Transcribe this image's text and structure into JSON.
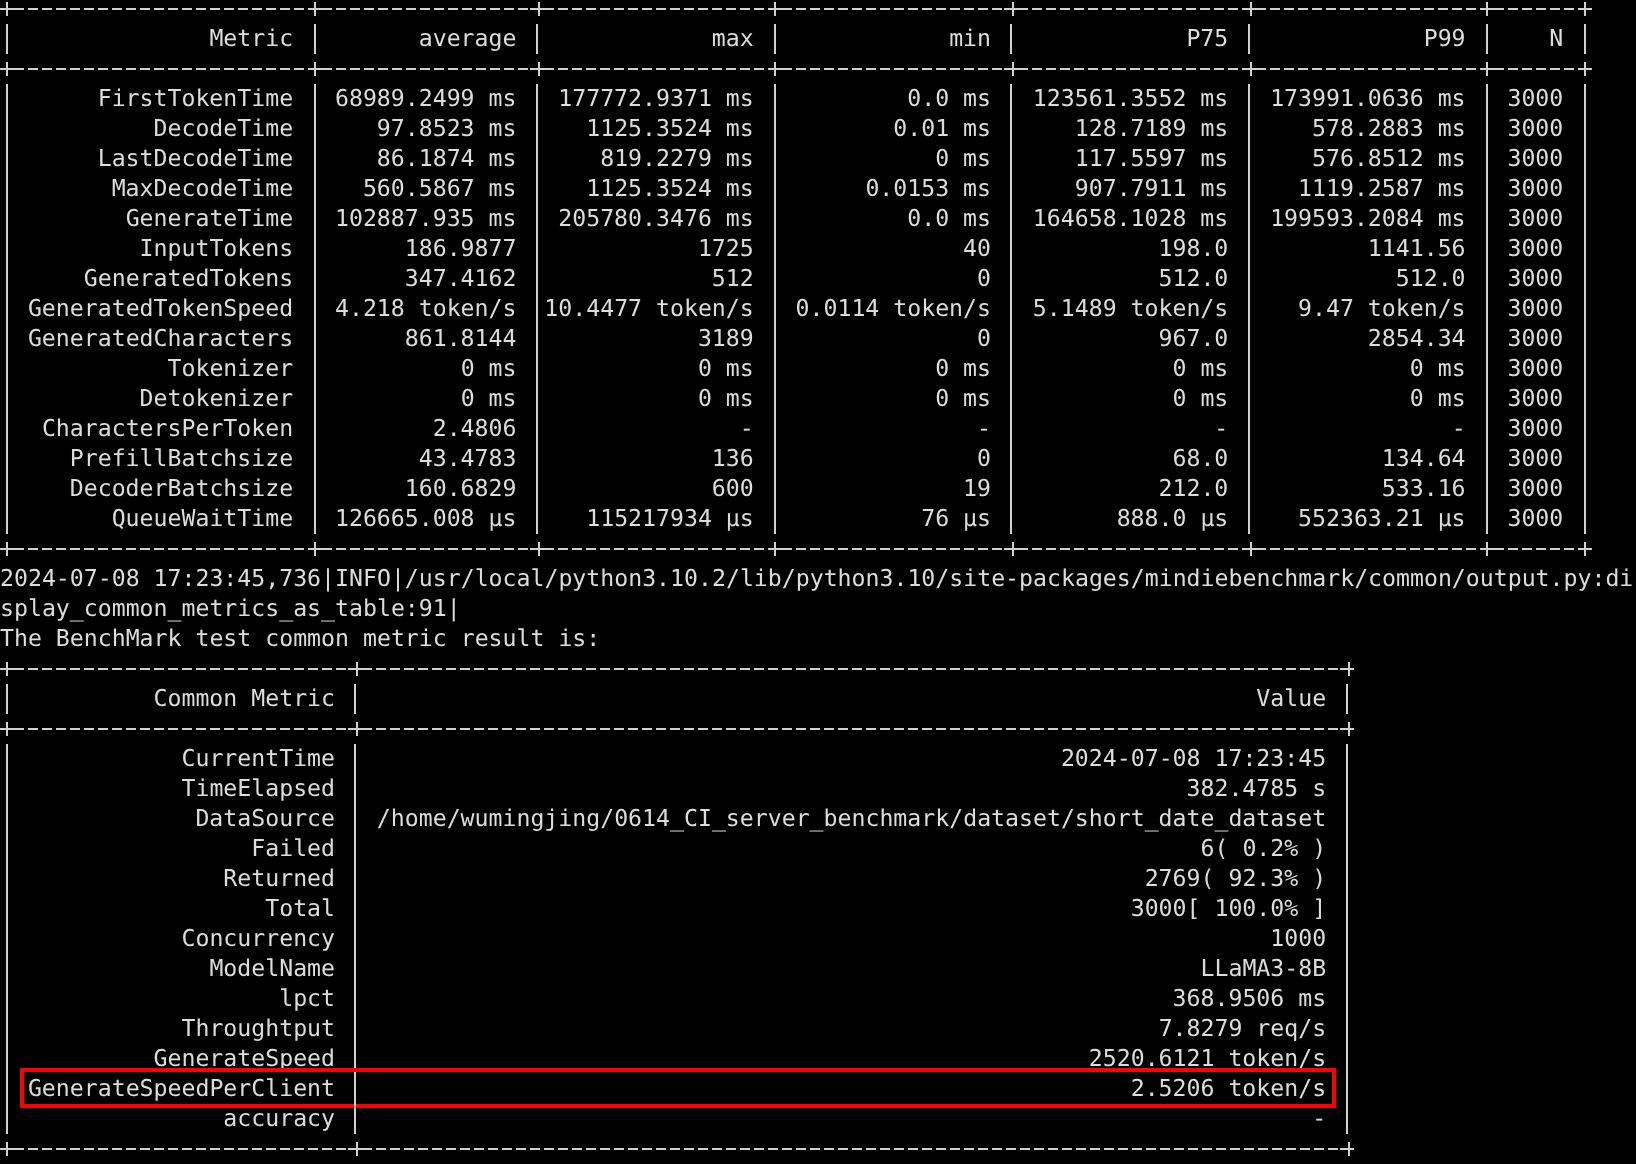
{
  "metrics_table": {
    "columns": [
      "Metric",
      "average",
      "max",
      "min",
      "P75",
      "P99",
      "N"
    ],
    "rows": [
      [
        "FirstTokenTime",
        "68989.2499 ms",
        "177772.9371 ms",
        "0.0 ms",
        "123561.3552 ms",
        "173991.0636 ms",
        "3000"
      ],
      [
        "DecodeTime",
        "97.8523 ms",
        "1125.3524 ms",
        "0.01 ms",
        "128.7189 ms",
        "578.2883 ms",
        "3000"
      ],
      [
        "LastDecodeTime",
        "86.1874 ms",
        "819.2279 ms",
        "0 ms",
        "117.5597 ms",
        "576.8512 ms",
        "3000"
      ],
      [
        "MaxDecodeTime",
        "560.5867 ms",
        "1125.3524 ms",
        "0.0153 ms",
        "907.7911 ms",
        "1119.2587 ms",
        "3000"
      ],
      [
        "GenerateTime",
        "102887.935 ms",
        "205780.3476 ms",
        "0.0 ms",
        "164658.1028 ms",
        "199593.2084 ms",
        "3000"
      ],
      [
        "InputTokens",
        "186.9877",
        "1725",
        "40",
        "198.0",
        "1141.56",
        "3000"
      ],
      [
        "GeneratedTokens",
        "347.4162",
        "512",
        "0",
        "512.0",
        "512.0",
        "3000"
      ],
      [
        "GeneratedTokenSpeed",
        "4.218 token/s",
        "10.4477 token/s",
        "0.0114 token/s",
        "5.1489 token/s",
        "9.47 token/s",
        "3000"
      ],
      [
        "GeneratedCharacters",
        "861.8144",
        "3189",
        "0",
        "967.0",
        "2854.34",
        "3000"
      ],
      [
        "Tokenizer",
        "0 ms",
        "0 ms",
        "0 ms",
        "0 ms",
        "0 ms",
        "3000"
      ],
      [
        "Detokenizer",
        "0 ms",
        "0 ms",
        "0 ms",
        "0 ms",
        "0 ms",
        "3000"
      ],
      [
        "CharactersPerToken",
        "2.4806",
        "-",
        "-",
        "-",
        "-",
        "3000"
      ],
      [
        "PrefillBatchsize",
        "43.4783",
        "136",
        "0",
        "68.0",
        "134.64",
        "3000"
      ],
      [
        "DecoderBatchsize",
        "160.6829",
        "600",
        "19",
        "212.0",
        "533.16",
        "3000"
      ],
      [
        "QueueWaitTime",
        "126665.008 µs",
        "115217934 µs",
        "76 µs",
        "888.0 µs",
        "552363.21 µs",
        "3000"
      ]
    ]
  },
  "log_lines": [
    "2024-07-08 17:23:45,736|INFO|/usr/local/python3.10.2/lib/python3.10/site-packages/mindiebenchmark/common/output.py:di",
    "splay_common_metrics_as_table:91|",
    "The BenchMark test common metric result is:"
  ],
  "common_table": {
    "columns": [
      "Common Metric",
      "Value"
    ],
    "rows": [
      {
        "cells": [
          "CurrentTime",
          "2024-07-08 17:23:45"
        ],
        "highlighted": false
      },
      {
        "cells": [
          "TimeElapsed",
          "382.4785 s"
        ],
        "highlighted": false
      },
      {
        "cells": [
          "DataSource",
          "/home/wumingjing/0614_CI_server_benchmark/dataset/short_date_dataset"
        ],
        "highlighted": false
      },
      {
        "cells": [
          "Failed",
          "6( 0.2% )"
        ],
        "highlighted": false
      },
      {
        "cells": [
          "Returned",
          "2769( 92.3% )"
        ],
        "highlighted": false
      },
      {
        "cells": [
          "Total",
          "3000[ 100.0% ]"
        ],
        "highlighted": false
      },
      {
        "cells": [
          "Concurrency",
          "1000"
        ],
        "highlighted": false
      },
      {
        "cells": [
          "ModelName",
          "LLaMA3-8B"
        ],
        "highlighted": false
      },
      {
        "cells": [
          "lpct",
          "368.9506 ms"
        ],
        "highlighted": false
      },
      {
        "cells": [
          "Throughtput",
          "7.8279 req/s"
        ],
        "highlighted": false
      },
      {
        "cells": [
          "GenerateSpeed",
          "2520.6121 token/s"
        ],
        "highlighted": false
      },
      {
        "cells": [
          "GenerateSpeedPerClient",
          "2.5206 token/s"
        ],
        "highlighted": true
      },
      {
        "cells": [
          "accuracy",
          "-"
        ],
        "highlighted": false
      }
    ]
  }
}
